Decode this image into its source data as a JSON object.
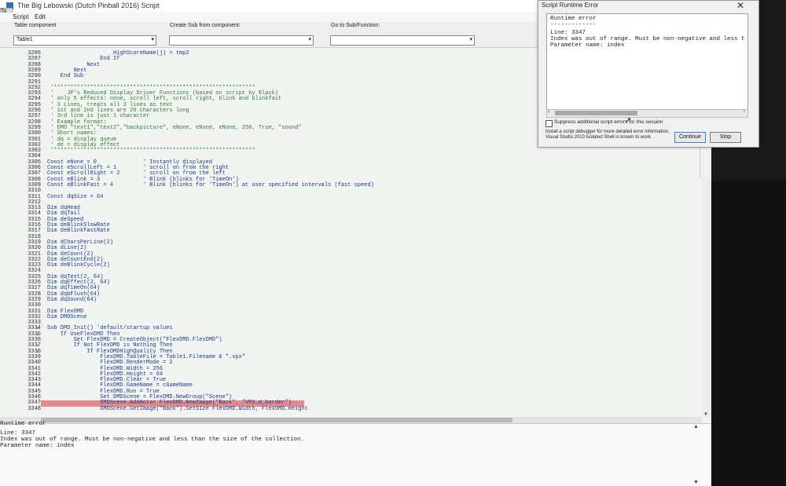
{
  "window": {
    "title": "The Big Lebowski (Dutch Pinball 2016) Script",
    "to_tab": "To"
  },
  "menu": [
    "Script",
    "Edit"
  ],
  "components": {
    "table_label": "Table component",
    "table_value": "Table1",
    "create_label": "Create Sub from component:",
    "create_value": "",
    "goto_label": "Go to Sub/Function:",
    "goto_value": ""
  },
  "code_lines": [
    {
      "n": "3286",
      "f": "",
      "t": "                    HighScoreName(j) = tmp2",
      "c": "norm"
    },
    {
      "n": "3287",
      "f": "",
      "t": "                End If",
      "c": "norm"
    },
    {
      "n": "3288",
      "f": "",
      "t": "            Next",
      "c": "norm"
    },
    {
      "n": "3289",
      "f": "",
      "t": "        Next",
      "c": "norm"
    },
    {
      "n": "3290",
      "f": "",
      "t": "    End Sub",
      "c": "norm"
    },
    {
      "n": "3291",
      "f": "",
      "t": "",
      "c": "norm"
    },
    {
      "n": "3292",
      "f": "",
      "t": " '*************************************************************",
      "c": "com"
    },
    {
      "n": "3293",
      "f": "",
      "t": " '    JP's Reduced Display Driver Functions (based on script by Black)",
      "c": "com"
    },
    {
      "n": "3294",
      "f": "",
      "t": " ' only 5 effects: none, scroll left, scroll right, blink and blinkfast",
      "c": "com"
    },
    {
      "n": "3295",
      "f": "",
      "t": " ' 3 Lines, treats all 3 lines as text",
      "c": "com"
    },
    {
      "n": "3296",
      "f": "",
      "t": " ' 1st and 2nd lines are 20 characters long",
      "c": "com"
    },
    {
      "n": "3297",
      "f": "",
      "t": " ' 3rd line is just 1 character",
      "c": "com"
    },
    {
      "n": "3298",
      "f": "",
      "t": " ' Example format:",
      "c": "com"
    },
    {
      "n": "3299",
      "f": "",
      "t": " ' DMD \"text1\",\"text2\",\"backpicture\", eNone, eNone, eNone, 250, True, \"sound\"",
      "c": "com"
    },
    {
      "n": "3300",
      "f": "",
      "t": " ' Short names:",
      "c": "com"
    },
    {
      "n": "3301",
      "f": "",
      "t": " ' dq = display queue",
      "c": "com"
    },
    {
      "n": "3302",
      "f": "",
      "t": " ' de = display effect",
      "c": "com"
    },
    {
      "n": "3303",
      "f": "",
      "t": " '*************************************************************",
      "c": "com"
    },
    {
      "n": "3304",
      "f": "",
      "t": "",
      "c": "norm"
    },
    {
      "n": "3305",
      "f": "",
      "t": "Const eNone = 0              ' Instantly displayed",
      "c": "norm"
    },
    {
      "n": "3306",
      "f": "",
      "t": "Const eScrollLeft = 1        ' scroll on from the right",
      "c": "norm"
    },
    {
      "n": "3307",
      "f": "",
      "t": "Const eScrollRight = 2       ' scroll on from the left",
      "c": "norm"
    },
    {
      "n": "3308",
      "f": "",
      "t": "Const eBlink = 3             ' Blink (blinks for 'TimeOn')",
      "c": "norm"
    },
    {
      "n": "3309",
      "f": "",
      "t": "Const eBlinkFast = 4         ' Blink (blinks for 'TimeOn') at user specified intervals (fast speed)",
      "c": "norm"
    },
    {
      "n": "3310",
      "f": "",
      "t": "",
      "c": "norm"
    },
    {
      "n": "3311",
      "f": "",
      "t": "Const dqSize = 64",
      "c": "norm"
    },
    {
      "n": "3312",
      "f": "",
      "t": "",
      "c": "norm"
    },
    {
      "n": "3313",
      "f": "",
      "t": "Dim dqHead",
      "c": "norm"
    },
    {
      "n": "3314",
      "f": "",
      "t": "Dim dqTail",
      "c": "norm"
    },
    {
      "n": "3315",
      "f": "",
      "t": "Dim deSpeed",
      "c": "norm"
    },
    {
      "n": "3316",
      "f": "",
      "t": "Dim deBlinkSlowRate",
      "c": "norm"
    },
    {
      "n": "3317",
      "f": "",
      "t": "Dim deBlinkFastRate",
      "c": "norm"
    },
    {
      "n": "3318",
      "f": "",
      "t": "",
      "c": "norm"
    },
    {
      "n": "3319",
      "f": "",
      "t": "Dim dCharsPerLine(2)",
      "c": "norm"
    },
    {
      "n": "3320",
      "f": "",
      "t": "Dim dLine(2)",
      "c": "norm"
    },
    {
      "n": "3321",
      "f": "",
      "t": "Dim deCount(2)",
      "c": "norm"
    },
    {
      "n": "3322",
      "f": "",
      "t": "Dim deCountEnd(2)",
      "c": "norm"
    },
    {
      "n": "3323",
      "f": "",
      "t": "Dim deBlinkCycle(2)",
      "c": "norm"
    },
    {
      "n": "3324",
      "f": "",
      "t": "",
      "c": "norm"
    },
    {
      "n": "3325",
      "f": "",
      "t": "Dim dqText(2, 64)",
      "c": "norm"
    },
    {
      "n": "3326",
      "f": "",
      "t": "Dim dqEffect(2, 64)",
      "c": "norm"
    },
    {
      "n": "3327",
      "f": "",
      "t": "Dim dqTimeOn(64)",
      "c": "norm"
    },
    {
      "n": "3328",
      "f": "",
      "t": "Dim dqbFlush(64)",
      "c": "norm"
    },
    {
      "n": "3329",
      "f": "",
      "t": "Dim dqSound(64)",
      "c": "norm"
    },
    {
      "n": "3330",
      "f": "",
      "t": "",
      "c": "norm"
    },
    {
      "n": "3331",
      "f": "",
      "t": "Dim FlexDMD",
      "c": "norm"
    },
    {
      "n": "3332",
      "f": "",
      "t": "Dim DMDScene",
      "c": "norm"
    },
    {
      "n": "3333",
      "f": "",
      "t": "",
      "c": "norm"
    },
    {
      "n": "3334",
      "f": "=",
      "t": "Sub DMD_Init() 'default/startup values",
      "c": "norm"
    },
    {
      "n": "3335",
      "f": "=",
      "t": "    If UseFlexDMD Then",
      "c": "norm"
    },
    {
      "n": "3336",
      "f": "",
      "t": "        Set FlexDMD = CreateObject(\"FlexDMD.FlexDMD\")",
      "c": "norm"
    },
    {
      "n": "3337",
      "f": "=",
      "t": "        If Not FlexDMD is Nothing Then",
      "c": "norm"
    },
    {
      "n": "3338",
      "f": "=",
      "t": "            If FlexDMDHighQuality Then",
      "c": "norm"
    },
    {
      "n": "3339",
      "f": "",
      "t": "                FlexDMD.TableFile = Table1.Filename & \".vpx\"",
      "c": "norm"
    },
    {
      "n": "3340",
      "f": "",
      "t": "                FlexDMD.RenderMode = 2",
      "c": "norm"
    },
    {
      "n": "3341",
      "f": "",
      "t": "                FlexDMD.Width = 256",
      "c": "norm"
    },
    {
      "n": "3342",
      "f": "",
      "t": "                FlexDMD.Height = 64",
      "c": "norm"
    },
    {
      "n": "3343",
      "f": "",
      "t": "                FlexDMD.Clear = True",
      "c": "norm"
    },
    {
      "n": "3344",
      "f": "",
      "t": "                FlexDMD.GameName = cGameName",
      "c": "norm"
    },
    {
      "n": "3345",
      "f": "",
      "t": "                FlexDMD.Run = True",
      "c": "norm"
    },
    {
      "n": "3346",
      "f": "",
      "t": "                Set DMDScene = FlexDMD.NewGroup(\"Scene\")",
      "c": "norm"
    },
    {
      "n": "3347",
      "f": "",
      "t": "                DMDScene.AddActor FlexDMD.NewImage(\"Back\", \"VPX.d_border\")",
      "c": "norm",
      "err": true
    },
    {
      "n": "3348",
      "f": "",
      "t": "                DMDScene.GetImage(\"Back\").SetSize FlexDMD.Width, FlexDMD.Height",
      "c": "norm"
    }
  ],
  "output": {
    "title": "Runtime error",
    "lines": [
      "Line: 3347",
      "Index was out of range. Must be non-negative and less than the size of the collection.",
      "Parameter name: index"
    ]
  },
  "dialog": {
    "title": "Script Runtime Error",
    "close": "✕",
    "message_lines": [
      "Runtime error",
      "-------------",
      "Line: 3347",
      "Index was out of range. Must be non-negative and less t",
      "Parameter name: index"
    ],
    "suppress_label": "Suppress additional script errors for this session",
    "info_line1": "Install a script debugger for more detailed error information.",
    "info_line2": "Visual Studio 2010 Isolated Shell is known to work.",
    "continue_label": "Continue",
    "stop_label": "Stop"
  },
  "icons": {
    "scroll_up": "▲",
    "scroll_down": "▼",
    "scroll_left": "‹",
    "scroll_right": "›",
    "dropdown": "▾"
  },
  "colors": {
    "code_text": "#1a3a8a",
    "comment_text": "#2f7a2f",
    "error_highlight": "#e48a8a",
    "editor_bg": "#f1f4f1"
  }
}
